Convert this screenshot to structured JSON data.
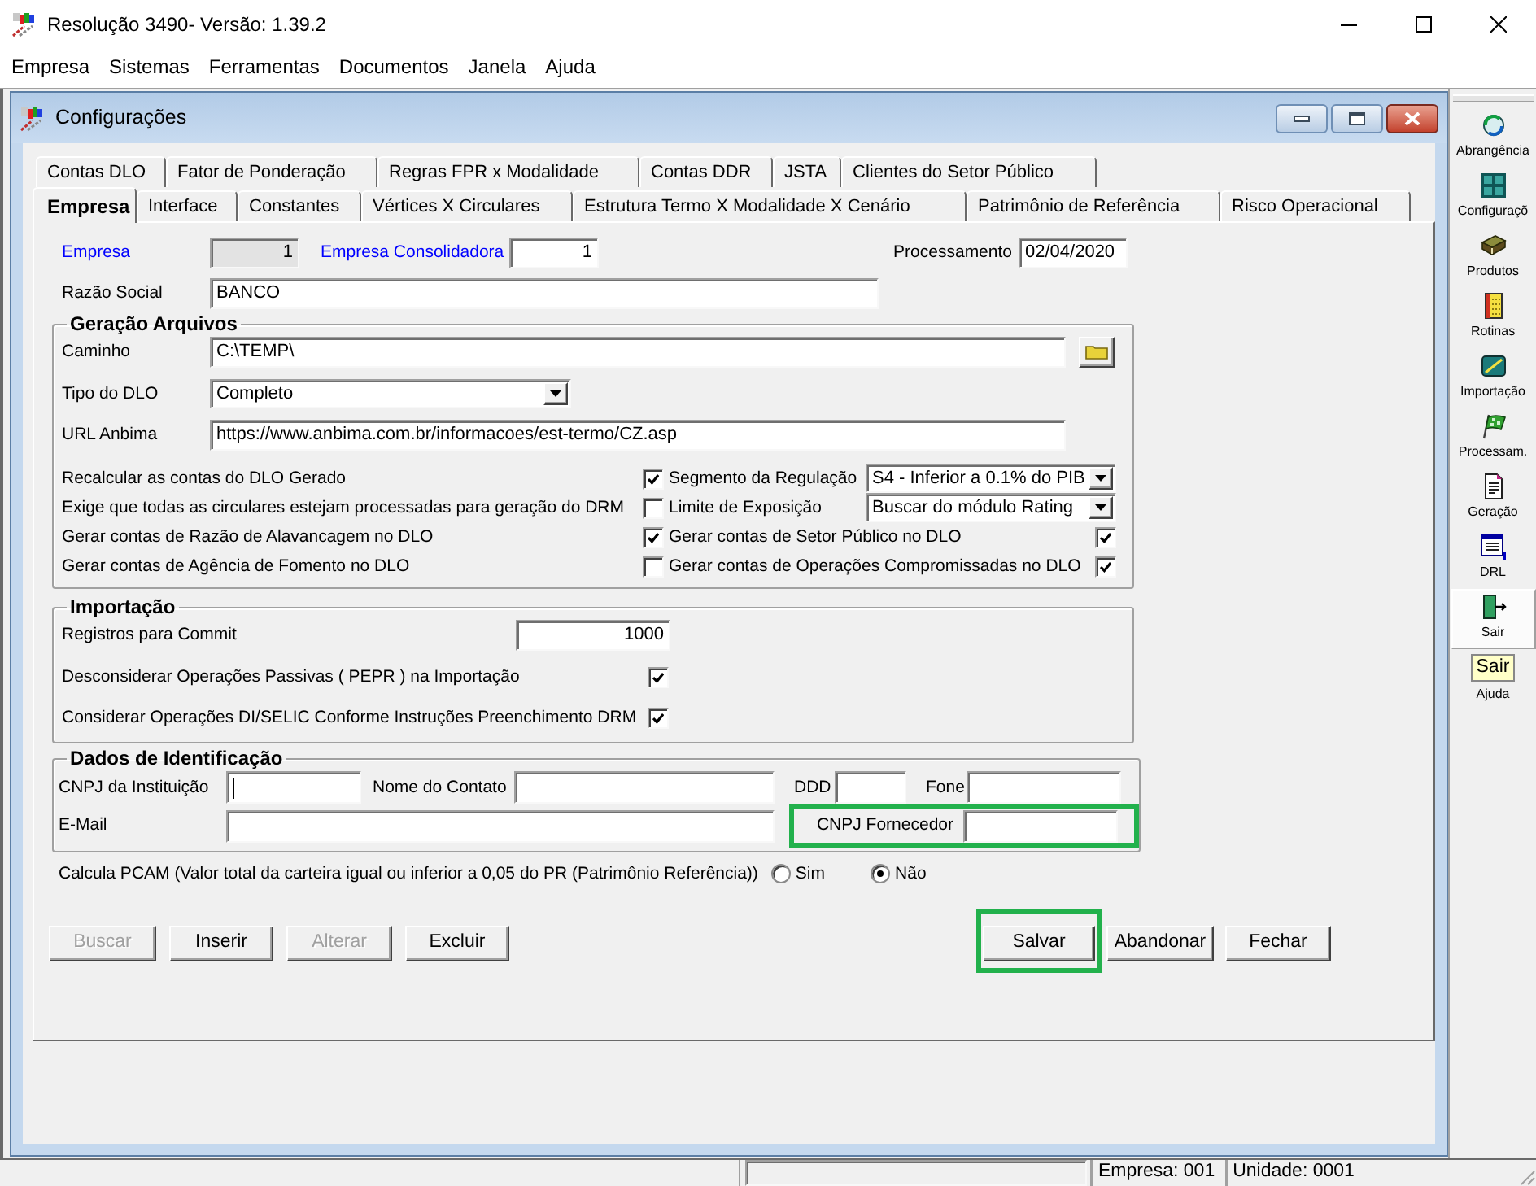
{
  "window": {
    "title": "Resolução 3490- Versão: 1.39.2"
  },
  "menu": [
    "Empresa",
    "Sistemas",
    "Ferramentas",
    "Documentos",
    "Janela",
    "Ajuda"
  ],
  "child_window": {
    "title": "Configurações"
  },
  "tabs": {
    "back_row": [
      {
        "label": "Contas DLO",
        "selected": false
      },
      {
        "label": "Fator de Ponderação",
        "selected": false
      },
      {
        "label": "Regras FPR x Modalidade",
        "selected": false
      },
      {
        "label": "Contas DDR",
        "selected": false
      },
      {
        "label": "JSTA",
        "selected": false
      },
      {
        "label": "Clientes do Setor Público",
        "selected": false
      }
    ],
    "front_row": [
      {
        "label": "Empresa",
        "selected": true
      },
      {
        "label": "Interface",
        "selected": false
      },
      {
        "label": "Constantes",
        "selected": false
      },
      {
        "label": "Vértices X Circulares",
        "selected": false
      },
      {
        "label": "Estrutura Termo X Modalidade X Cenário",
        "selected": false
      },
      {
        "label": "Patrimônio de Referência",
        "selected": false
      },
      {
        "label": "Risco Operacional",
        "selected": false
      }
    ]
  },
  "header_row": [
    {
      "label": "Empresa",
      "color": "#0000ff",
      "value": "1",
      "disabled": true
    },
    {
      "label": "Empresa Consolidadora",
      "color": "#0000ff",
      "value": "1",
      "disabled": false
    },
    {
      "label": "Processamento",
      "color": "#000000",
      "value": "02/04/2020",
      "disabled": false
    }
  ],
  "razao_social": {
    "label": "Razão Social",
    "value": "BANCO"
  },
  "geracao_arquivos": {
    "title": "Geração Arquivos",
    "caminho": {
      "label": "Caminho",
      "value": "C:\\TEMP\\"
    },
    "tipo_dlo": {
      "label": "Tipo do DLO",
      "value": "Completo"
    },
    "url_anbima": {
      "label": "URL Anbima",
      "value": "https://www.anbima.com.br/informacoes/est-termo/CZ.asp"
    },
    "rows": [
      {
        "label": "Recalcular as contas do DLO Gerado",
        "checked": true,
        "right": {
          "kind": "select",
          "label": "Segmento da Regulação",
          "value": "S4 - Inferior a 0.1% do PIB"
        }
      },
      {
        "label": "Exige que todas as circulares estejam processadas para geração do DRM",
        "checked": false,
        "right": {
          "kind": "select",
          "label": "Limite de Exposição",
          "value": "Buscar do módulo Rating"
        }
      },
      {
        "label": "Gerar contas de Razão de Alavancagem no DLO",
        "checked": true,
        "right": {
          "kind": "checkbox",
          "label": "Gerar contas de Setor Público no DLO",
          "checked": true
        }
      },
      {
        "label": "Gerar contas de Agência de Fomento no DLO",
        "checked": false,
        "right": {
          "kind": "checkbox",
          "label": "Gerar contas de Operações Compromissadas no DLO",
          "checked": true
        }
      }
    ]
  },
  "importacao": {
    "title": "Importação",
    "registros": {
      "label": "Registros para Commit",
      "value": "1000"
    },
    "options": [
      {
        "label": "Desconsiderar Operações Passivas ( PEPR ) na Importação",
        "checked": true
      },
      {
        "label": "Considerar Operações DI/SELIC Conforme Instruções Preenchimento DRM",
        "checked": true
      }
    ]
  },
  "dados_identificacao": {
    "title": "Dados de Identificação",
    "row_1": [
      {
        "label": "CNPJ da Instituição",
        "focused": true
      },
      {
        "label": "Nome do Contato",
        "focused": false
      },
      {
        "label": "DDD",
        "focused": false
      },
      {
        "label": "Fone",
        "focused": false
      }
    ],
    "email": {
      "label": "E-Mail"
    },
    "cnpj_fornecedor": {
      "label": "CNPJ Fornecedor",
      "highlighted": true
    }
  },
  "pcam": {
    "label": "Calcula PCAM (Valor total da carteira igual ou inferior a 0,05 do PR (Patrimônio Referência))",
    "options": [
      {
        "label": "Sim",
        "selected": false
      },
      {
        "label": "Não",
        "selected": true
      }
    ]
  },
  "buttons_left": [
    {
      "label": "Buscar",
      "disabled": true,
      "highlighted": false
    },
    {
      "label": "Inserir",
      "disabled": false,
      "highlighted": false
    },
    {
      "label": "Alterar",
      "disabled": true,
      "highlighted": false
    },
    {
      "label": "Excluir",
      "disabled": false,
      "highlighted": false
    }
  ],
  "buttons_right": [
    {
      "label": "Salvar",
      "disabled": false,
      "highlighted": true
    },
    {
      "label": "Abandonar",
      "disabled": false,
      "highlighted": false
    },
    {
      "label": "Fechar",
      "disabled": false,
      "highlighted": false
    }
  ],
  "toolbar": [
    {
      "label": "Abrangência",
      "kind": "scope",
      "selected": false
    },
    {
      "label": "Configuraçõ",
      "kind": "config",
      "selected": false
    },
    {
      "label": "Produtos",
      "kind": "products",
      "selected": false
    },
    {
      "label": "Rotinas",
      "kind": "routines",
      "selected": false
    },
    {
      "label": "Importação",
      "kind": "import",
      "selected": false
    },
    {
      "label": "Processam.",
      "kind": "process",
      "selected": false
    },
    {
      "label": "Geração",
      "kind": "generate",
      "selected": false
    },
    {
      "label": "DRL",
      "kind": "report",
      "selected": false
    },
    {
      "label": "Sair",
      "kind": "exit",
      "selected": true
    },
    {
      "label": "Ajuda",
      "kind": "help",
      "icon_text": "Sair",
      "selected": false
    }
  ],
  "status_bar": {
    "panels": [
      "Empresa: 001",
      "Unidade: 0001"
    ]
  }
}
